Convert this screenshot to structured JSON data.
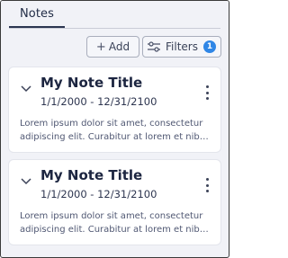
{
  "tabs": [
    {
      "label": "Notes"
    }
  ],
  "toolbar": {
    "add_label": "Add",
    "filters_label": "Filters",
    "filters_count": "1",
    "badge_color": "#2f86e6"
  },
  "notes": [
    {
      "title": "My Note Title",
      "dates": "1/1/2000 - 12/31/2100",
      "body_line1": "Lorem ipsum dolor sit amet, consectetur",
      "body_line2": "adipiscing elit. Curabitur at lorem et nibh sc..."
    },
    {
      "title": "My Note Title",
      "dates": "1/1/2000 - 12/31/2100",
      "body_line1": "Lorem ipsum dolor sit amet, consectetur",
      "body_line2": "adipiscing elit. Curabitur at lorem et nibh sc..."
    }
  ]
}
